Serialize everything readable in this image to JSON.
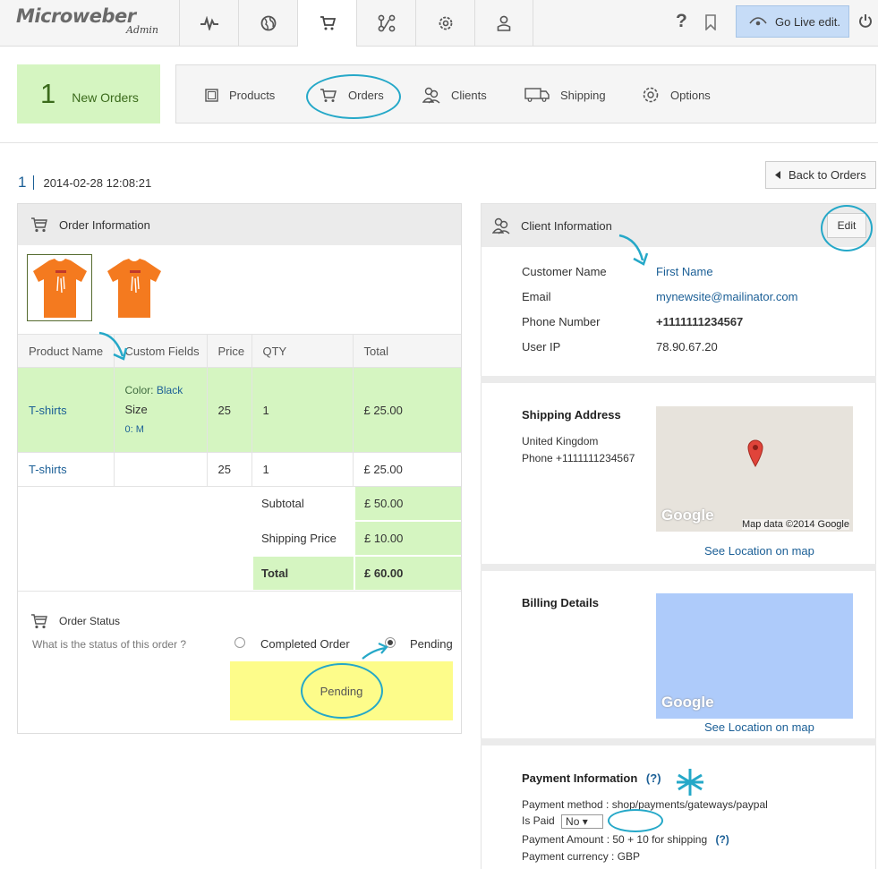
{
  "logo": {
    "brand": "Microweber",
    "sub": "Admin"
  },
  "topnav": {
    "items": [
      {
        "icon": "pulse-icon",
        "active": false
      },
      {
        "icon": "globe-icon",
        "active": false
      },
      {
        "icon": "cart-icon",
        "active": true
      },
      {
        "icon": "modules-icon",
        "active": false
      },
      {
        "icon": "gear-icon",
        "active": false
      },
      {
        "icon": "user-icon",
        "active": false
      }
    ],
    "help": "?",
    "golive": "Go Live edit."
  },
  "neworders": {
    "count": "1",
    "label": "New Orders"
  },
  "shopnav": {
    "products": "Products",
    "orders": "Orders",
    "clients": "Clients",
    "shipping": "Shipping",
    "options": "Options"
  },
  "order": {
    "id": "1",
    "date": "2014-02-28 12:08:21",
    "back": "Back to Orders"
  },
  "order_info": {
    "title": "Order Information",
    "columns": [
      "Product Name",
      "Custom Fields",
      "Price",
      "QTY",
      "Total"
    ],
    "rows": [
      {
        "name": "T-shirts",
        "color_label": "Color:",
        "color_value": "Black",
        "size_label": "Size",
        "size_value": "0: M",
        "price": "25",
        "qty": "1",
        "total": "£ 25.00"
      },
      {
        "name": "T-shirts",
        "price": "25",
        "qty": "1",
        "total": "£ 25.00"
      }
    ],
    "subtotal_label": "Subtotal",
    "subtotal": "£ 50.00",
    "shipping_label": "Shipping Price",
    "shipping": "£ 10.00",
    "total_label": "Total",
    "total": "£ 60.00"
  },
  "status": {
    "title": "Order Status",
    "question": "What is the status of this order ?",
    "completed": "Completed Order",
    "pending": "Pending",
    "current": "Pending"
  },
  "client": {
    "title": "Client Information",
    "edit": "Edit",
    "name_label": "Customer Name",
    "name": "First Name",
    "email_label": "Email",
    "email": "mynewsite@mailinator.com",
    "phone_label": "Phone Number",
    "phone": "+1111111234567",
    "ip_label": "User IP",
    "ip": "78.90.67.20"
  },
  "shipping_address": {
    "title": "Shipping Address",
    "country": "United Kingdom",
    "phone": "Phone +1111111234567",
    "map_credit": "Map data ©2014 Google",
    "google": "Google",
    "see": "See Location on map"
  },
  "billing": {
    "title": "Billing Details",
    "google": "Google",
    "see": "See Location on map"
  },
  "payment": {
    "title": "Payment Information",
    "help": "(?)",
    "method": "Payment method : shop/payments/gateways/paypal",
    "paid_label": "Is Paid",
    "paid": "No ▾",
    "amount": "Payment Amount : 50 + 10 for shipping",
    "currency": "Payment currency : GBP"
  },
  "colors": {
    "accent": "#1b5f96",
    "green": "#d5f5c1",
    "highlight": "#fdfc8a",
    "annotation": "#25a8c8",
    "golive": "#c6dcf7"
  }
}
